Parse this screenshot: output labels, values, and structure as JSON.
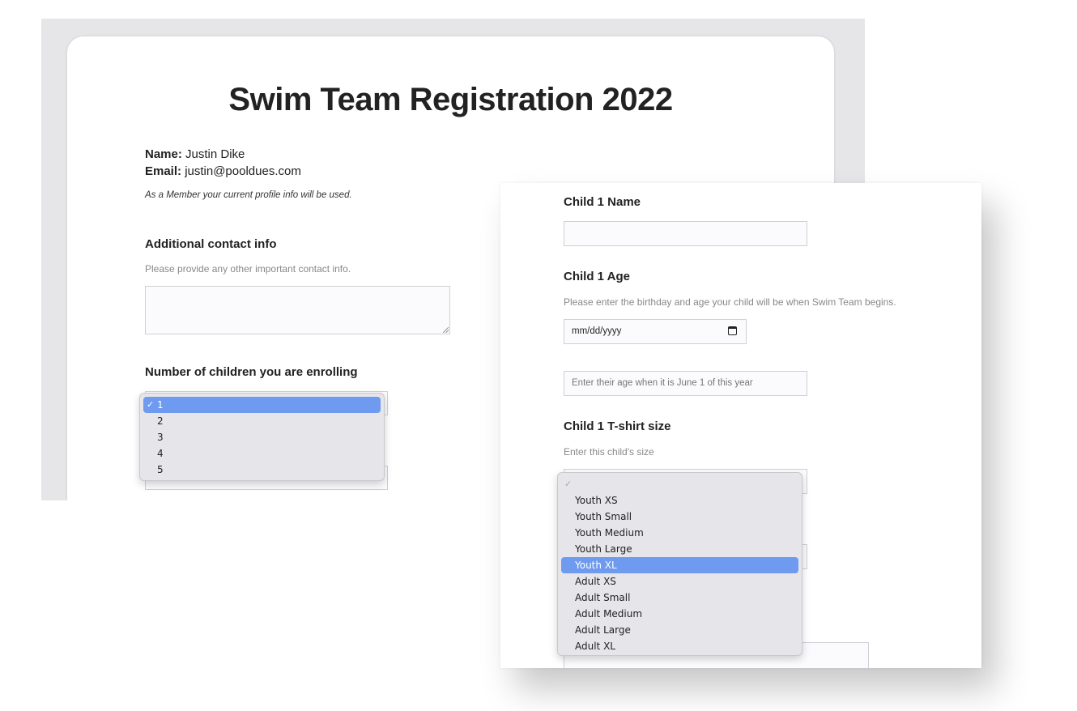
{
  "back_form": {
    "title": "Swim Team Registration 2022",
    "profile": {
      "name_label": "Name:",
      "name_value": "Justin Dike",
      "email_label": "Email:",
      "email_value": "justin@pooldues.com",
      "note": "As a Member your current profile info will be used."
    },
    "additional_contact": {
      "label": "Additional contact info",
      "help": "Please provide any other important contact info."
    },
    "children_count": {
      "label": "Number of children you are enrolling",
      "selected": "1",
      "options": [
        "1",
        "2",
        "3",
        "4",
        "5"
      ]
    }
  },
  "front_form": {
    "child_name": {
      "label": "Child 1 Name"
    },
    "child_age": {
      "label": "Child 1 Age",
      "help": "Please enter the birthday and age your child will be when Swim Team begins.",
      "date_placeholder": "mm/dd/yyyy",
      "age_placeholder": "Enter their age when it is June 1 of this year"
    },
    "tshirt": {
      "label": "Child 1 T-shirt size",
      "help": "Enter this child's size",
      "selected": "Youth XL",
      "options": [
        "",
        "Youth XS",
        "Youth Small",
        "Youth Medium",
        "Youth Large",
        "Youth XL",
        "Adult XS",
        "Adult Small",
        "Adult Medium",
        "Adult Large",
        "Adult XL"
      ]
    }
  },
  "icons": {
    "checkmark": "✓",
    "calendar": "calendar-icon"
  }
}
